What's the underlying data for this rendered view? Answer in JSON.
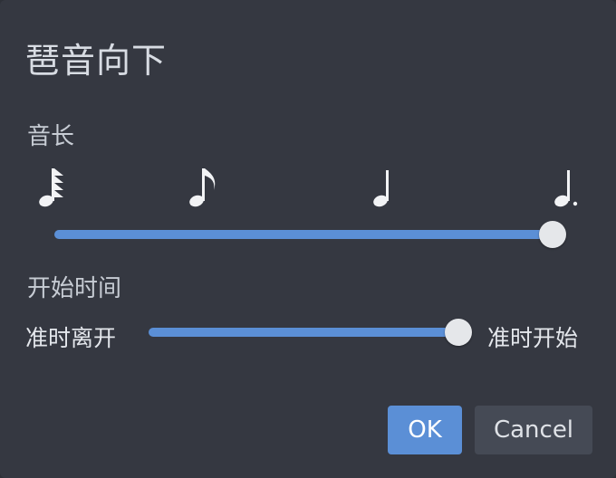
{
  "dialog": {
    "title": "琶音向下",
    "length_section": {
      "label": "音长",
      "notes": [
        "sixty-fourth-note-icon",
        "eighth-note-icon",
        "quarter-note-icon",
        "dotted-quarter-note-icon"
      ],
      "slider_value_fraction": 1.0
    },
    "start_section": {
      "label": "开始时间",
      "left_label": "准时离开",
      "right_label": "准时开始",
      "slider_value_fraction": 1.0
    },
    "buttons": {
      "ok": "OK",
      "cancel": "Cancel"
    }
  },
  "colors": {
    "background": "#353841",
    "accent": "#5b8fd6",
    "thumb": "#e5e7ea",
    "cancel_button": "#454a55"
  }
}
